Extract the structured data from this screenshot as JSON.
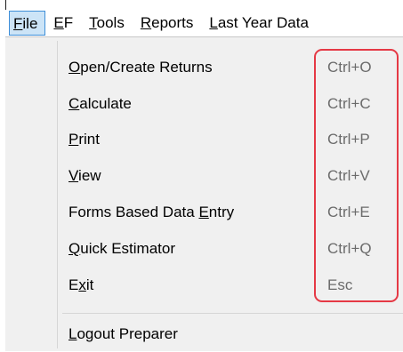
{
  "menubar": {
    "items": [
      {
        "accel": "F",
        "rest": "ile",
        "active": true
      },
      {
        "accel": "E",
        "rest": "F"
      },
      {
        "accel": "T",
        "rest": "ools"
      },
      {
        "accel": "R",
        "rest": "eports"
      },
      {
        "accel": "L",
        "rest": "ast Year Data"
      }
    ]
  },
  "file_menu": {
    "items": [
      {
        "pre": "",
        "accel": "O",
        "post": "pen/Create Returns",
        "shortcut": "Ctrl+O"
      },
      {
        "pre": "",
        "accel": "C",
        "post": "alculate",
        "shortcut": "Ctrl+C"
      },
      {
        "pre": "",
        "accel": "P",
        "post": "rint",
        "shortcut": "Ctrl+P"
      },
      {
        "pre": "",
        "accel": "V",
        "post": "iew",
        "shortcut": "Ctrl+V"
      },
      {
        "pre": "Forms Based Data ",
        "accel": "E",
        "post": "ntry",
        "shortcut": "Ctrl+E"
      },
      {
        "pre": "",
        "accel": "Q",
        "post": "uick Estimator",
        "shortcut": "Ctrl+Q"
      },
      {
        "pre": "E",
        "accel": "x",
        "post": "it",
        "shortcut": "Esc"
      },
      {
        "pre": "",
        "accel": "L",
        "post": "ogout Preparer",
        "shortcut": ""
      }
    ]
  },
  "colors": {
    "menu_background": "#f0f0f0",
    "active_menu_highlight": "#cce4f7",
    "shortcut_text": "#6b6b6b",
    "annotation_box": "#e53945"
  }
}
